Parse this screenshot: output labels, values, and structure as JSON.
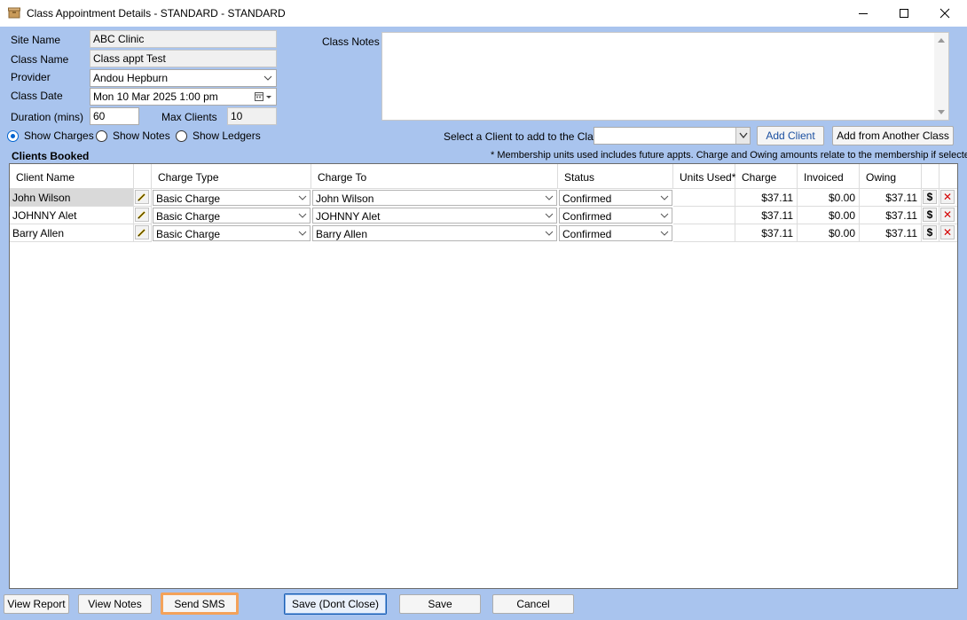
{
  "window": {
    "title": "Class Appointment Details - STANDARD - STANDARD"
  },
  "form": {
    "site_name_label": "Site Name",
    "site_name": "ABC Clinic",
    "class_name_label": "Class Name",
    "class_name": "Class appt Test",
    "provider_label": "Provider",
    "provider": "Andou Hepburn",
    "class_date_label": "Class Date",
    "class_date": "Mon 10 Mar 2025   1:00 pm",
    "duration_label": "Duration (mins)",
    "duration": "60",
    "max_clients_label": "Max Clients",
    "max_clients": "10",
    "class_notes_label": "Class Notes",
    "class_notes": ""
  },
  "view_options": {
    "show_charges": "Show Charges",
    "show_notes": "Show Notes",
    "show_ledgers": "Show Ledgers",
    "selected": "show_charges"
  },
  "add_client": {
    "label": "Select a Client to add to the Class",
    "selected": "",
    "add_button": "Add Client",
    "add_other_button": "Add from Another Class"
  },
  "clients": {
    "heading": "Clients Booked",
    "note": "* Membership units used includes future appts. Charge and Owing amounts relate to the membership if selected",
    "columns": [
      "Client Name",
      "",
      "Charge Type",
      "Charge To",
      "Status",
      "Units Used*",
      "Charge",
      "Invoiced",
      "Owing"
    ],
    "rows": [
      {
        "client": "John Wilson",
        "charge_type": "Basic Charge",
        "charge_to": "John Wilson",
        "status": "Confirmed",
        "units": "",
        "charge": "$37.11",
        "invoiced": "$0.00",
        "owing": "$37.11"
      },
      {
        "client": "JOHNNY Alet",
        "charge_type": "Basic Charge",
        "charge_to": "JOHNNY Alet",
        "status": "Confirmed",
        "units": "",
        "charge": "$37.11",
        "invoiced": "$0.00",
        "owing": "$37.11"
      },
      {
        "client": "Barry Allen",
        "charge_type": "Basic Charge",
        "charge_to": "Barry Allen",
        "status": "Confirmed",
        "units": "",
        "charge": "$37.11",
        "invoiced": "$0.00",
        "owing": "$37.11"
      }
    ],
    "row_icons": {
      "edit": "pencil-icon",
      "payment": "dollar-icon",
      "remove": "delete-x-icon",
      "payment_glyph": "$",
      "remove_glyph": "✕"
    }
  },
  "footer": {
    "view_report": "View Report",
    "view_notes": "View Notes",
    "send_sms": "Send SMS",
    "save_dont_close": "Save (Dont Close)",
    "save": "Save",
    "cancel": "Cancel"
  },
  "colors": {
    "client_bg": "#a9c4ee",
    "sms_highlight": "#f3a25a",
    "delete_red": "#d40000"
  }
}
